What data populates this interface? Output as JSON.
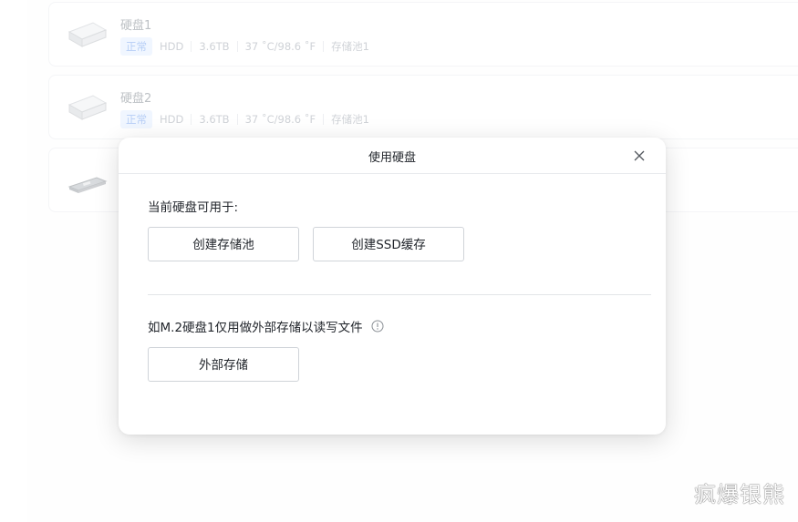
{
  "disks": [
    {
      "title": "硬盘1",
      "status": "正常",
      "type": "HDD",
      "capacity": "3.6TB",
      "temp": "37 ˚C/98.6 ˚F",
      "pool": "存储池1"
    },
    {
      "title": "硬盘2",
      "status": "正常",
      "type": "HDD",
      "capacity": "3.6TB",
      "temp": "37 ˚C/98.6 ˚F",
      "pool": "存储池1"
    }
  ],
  "modal": {
    "title": "使用硬盘",
    "section1_label": "当前硬盘可用于:",
    "btn_create_pool": "创建存储池",
    "btn_ssd_cache": "创建SSD缓存",
    "section2_label": "如M.2硬盘1仅用做外部存储以读写文件",
    "btn_external": "外部存储"
  },
  "watermark": "疯爆银熊",
  "colors": {
    "badge_bg": "#e9f2ff",
    "badge_text": "#8fb4f2",
    "border": "#d0d4d9"
  }
}
